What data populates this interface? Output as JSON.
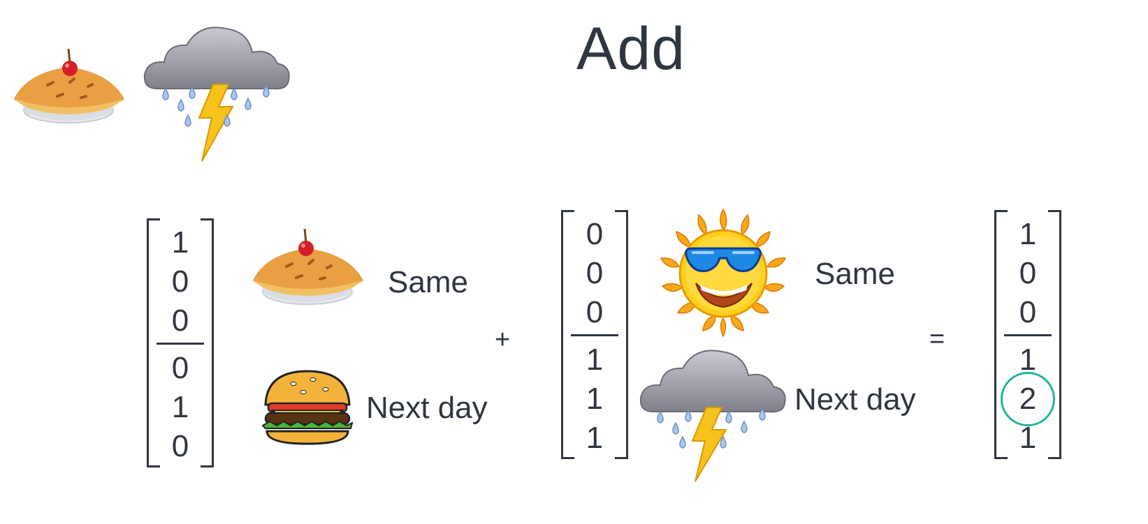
{
  "title": "Add",
  "header_icons": [
    "pie-icon",
    "storm-cloud-icon"
  ],
  "left_vector": {
    "values": [
      "1",
      "0",
      "0",
      "0",
      "1",
      "0"
    ],
    "same_label": "Same",
    "same_icon": "pie-icon",
    "next_label": "Next day",
    "next_icon": "burger-icon"
  },
  "operator_plus": "+",
  "middle_vector": {
    "values": [
      "0",
      "0",
      "0",
      "1",
      "1",
      "1"
    ],
    "same_label": "Same",
    "same_icon": "sun-with-sunglasses-icon",
    "next_label": "Next day",
    "next_icon": "storm-cloud-icon"
  },
  "operator_equals": "=",
  "result_vector": {
    "values": [
      "1",
      "0",
      "0",
      "1",
      "2",
      "1"
    ],
    "highlighted_value": "2",
    "highlight_color": "#1fb59a"
  }
}
